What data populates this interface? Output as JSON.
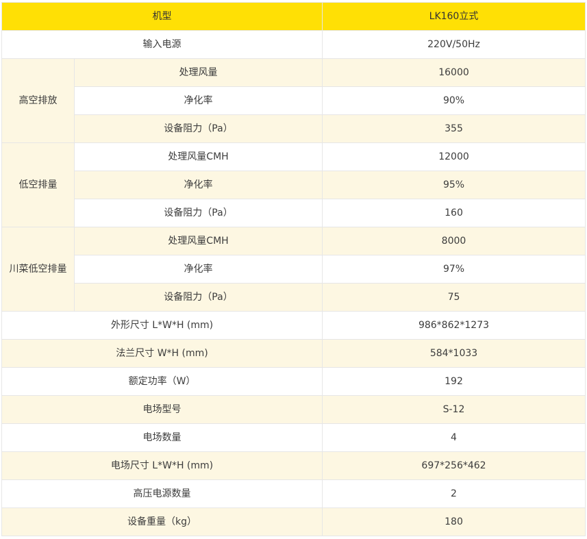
{
  "header": {
    "label": "机型",
    "value": "LK160立式"
  },
  "input_power": {
    "label": "输入电源",
    "value": "220V/50Hz"
  },
  "groups": [
    {
      "name": "高空排放",
      "rows": [
        {
          "label": "处理风量",
          "value": "16000"
        },
        {
          "label": "净化率",
          "value": "90%"
        },
        {
          "label": "设备阻力（Pa）",
          "value": "355"
        }
      ]
    },
    {
      "name": "低空排量",
      "rows": [
        {
          "label": "处理风量CMH",
          "value": "12000"
        },
        {
          "label": "净化率",
          "value": "95%"
        },
        {
          "label": "设备阻力（Pa）",
          "value": "160"
        }
      ]
    },
    {
      "name": "川菜低空排量",
      "rows": [
        {
          "label": "处理风量CMH",
          "value": "8000"
        },
        {
          "label": "净化率",
          "value": "97%"
        },
        {
          "label": "设备阻力（Pa）",
          "value": "75"
        }
      ]
    }
  ],
  "specs": [
    {
      "label": "外形尺寸 L*W*H (mm)",
      "value": "986*862*1273"
    },
    {
      "label": "法兰尺寸 W*H (mm)",
      "value": "584*1033"
    },
    {
      "label": "额定功率（W）",
      "value": "192"
    },
    {
      "label": "电场型号",
      "value": "S-12"
    },
    {
      "label": "电场数量",
      "value": "4"
    },
    {
      "label": "电场尺寸 L*W*H (mm)",
      "value": "697*256*462"
    },
    {
      "label": "高压电源数量",
      "value": "2"
    },
    {
      "label": "设备重量（kg）",
      "value": "180"
    }
  ]
}
